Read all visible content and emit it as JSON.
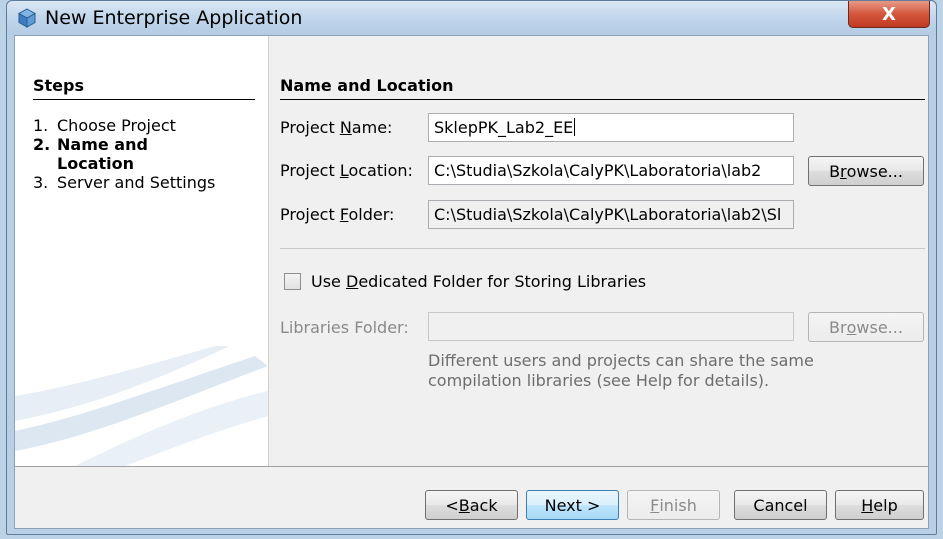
{
  "window": {
    "title": "New Enterprise Application",
    "close_glyph": "X"
  },
  "steps": {
    "title": "Steps",
    "items": [
      {
        "num": "1.",
        "label": "Choose Project"
      },
      {
        "num": "2.",
        "label": "Name and Location"
      },
      {
        "num": "3.",
        "label": "Server and Settings"
      }
    ]
  },
  "form": {
    "section_title": "Name and Location",
    "project_name": {
      "label_pre": "Project ",
      "label_key": "N",
      "label_post": "ame:",
      "value": "SklepPK_Lab2_EE"
    },
    "project_location": {
      "label_pre": "Project ",
      "label_key": "L",
      "label_post": "ocation:",
      "value": "C:\\Studia\\Szkola\\CalyPK\\Laboratoria\\lab2"
    },
    "project_folder": {
      "label_pre": "Project ",
      "label_key": "F",
      "label_post": "older:",
      "value": "C:\\Studia\\Szkola\\CalyPK\\Laboratoria\\lab2\\Sl"
    },
    "browse1": {
      "pre": "B",
      "key": "r",
      "post": "owse..."
    },
    "dedicated": {
      "pre": "Use ",
      "key": "D",
      "post": "edicated Folder for Storing Libraries",
      "checked": false
    },
    "libraries_folder": {
      "label": "Libraries Folder:",
      "value": ""
    },
    "browse2": {
      "pre": "Br",
      "key": "o",
      "post": "wse..."
    },
    "help_text": "Different users and projects can share the same compilation libraries (see Help for details)."
  },
  "buttons": {
    "back": {
      "pre": "< ",
      "key": "B",
      "post": "ack"
    },
    "next": {
      "label": "Next >"
    },
    "finish": {
      "key": "F",
      "post": "inish"
    },
    "cancel": {
      "label": "Cancel"
    },
    "help": {
      "key": "H",
      "post": "elp"
    }
  },
  "colors": {
    "accent": "#3c7fb1",
    "close": "#c03a22",
    "frame": "#b9cfe5"
  },
  "icons": {
    "title": "netbeans-cube-icon",
    "close": "close-icon",
    "sidebar": "swoosh-graphic"
  }
}
